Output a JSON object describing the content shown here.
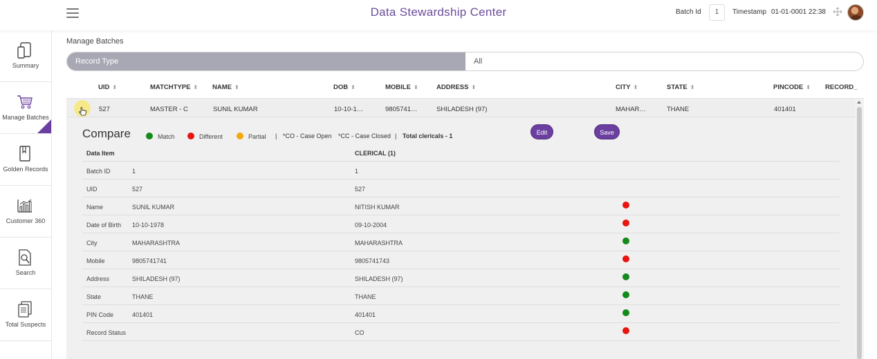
{
  "header": {
    "title": "Data Stewardship Center",
    "batch_label": "Batch Id",
    "batch_value": "1",
    "timestamp_label": "Timestamp",
    "timestamp_value": "01-01-0001 22:38"
  },
  "sidebar": {
    "items": [
      {
        "label": "Summary",
        "icon": "tablet-icon"
      },
      {
        "label": "Manage Batches",
        "icon": "cart-icon"
      },
      {
        "label": "Golden Records",
        "icon": "book-icon"
      },
      {
        "label": "Customer 360",
        "icon": "bar-chart-icon"
      },
      {
        "label": "Search",
        "icon": "search-doc-icon"
      },
      {
        "label": "Total Suspects",
        "icon": "copy-icon"
      }
    ]
  },
  "main": {
    "breadcrumb": "Manage Batches",
    "filter": {
      "label": "Record Type",
      "value": "All"
    },
    "columns": [
      "UID",
      "MATCHTYPE",
      "NAME",
      "DOB",
      "MOBILE",
      "ADDRESS",
      "CITY",
      "STATE",
      "PINCODE",
      "RECORD_"
    ],
    "row": {
      "uid": "527",
      "matchtype": "MASTER - C",
      "name": "SUNIL KUMAR",
      "dob": "10-10-1…",
      "mobile": "9805741…",
      "address": "SHILADESH (97)",
      "city": "MAHAR…",
      "state": "THANE",
      "pincode": "401401"
    }
  },
  "compare": {
    "title": "Compare",
    "legend": {
      "match": "Match",
      "different": "Different",
      "partial": "Partial",
      "sep1": "|",
      "co": "*CO - Case Open",
      "cc": "*CC - Case Closed",
      "sep2": "|",
      "total": "Total clericals - 1"
    },
    "edit_label": "Edit",
    "save_label": "Save",
    "headers": {
      "item": "Data Item",
      "clerical": "CLERICAL (1)"
    },
    "rows": [
      {
        "item": "Batch ID",
        "golden": "1",
        "clerical": "1",
        "status": ""
      },
      {
        "item": "UID",
        "golden": "527",
        "clerical": "527",
        "status": ""
      },
      {
        "item": "Name",
        "golden": "SUNIL KUMAR",
        "clerical": "NITISH KUMAR",
        "status": "different"
      },
      {
        "item": "Date of Birth",
        "golden": "10-10-1978",
        "clerical": "09-10-2004",
        "status": "different"
      },
      {
        "item": "City",
        "golden": "MAHARASHTRA",
        "clerical": "MAHARASHTRA",
        "status": "match"
      },
      {
        "item": "Mobile",
        "golden": "9805741741",
        "clerical": "9805741743",
        "status": "different"
      },
      {
        "item": "Address",
        "golden": " SHILADESH (97)",
        "clerical": " SHILADESH (97)",
        "status": "match"
      },
      {
        "item": "State",
        "golden": "THANE",
        "clerical": "THANE",
        "status": "match"
      },
      {
        "item": "PIN Code",
        "golden": "401401",
        "clerical": "401401",
        "status": "match"
      },
      {
        "item": "Record Status",
        "golden": "",
        "clerical": "CO",
        "status": "different"
      }
    ]
  },
  "colors": {
    "accent": "#6b3fa0",
    "match": "#138a1c",
    "different": "#e8150f",
    "partial": "#f2a70a"
  }
}
